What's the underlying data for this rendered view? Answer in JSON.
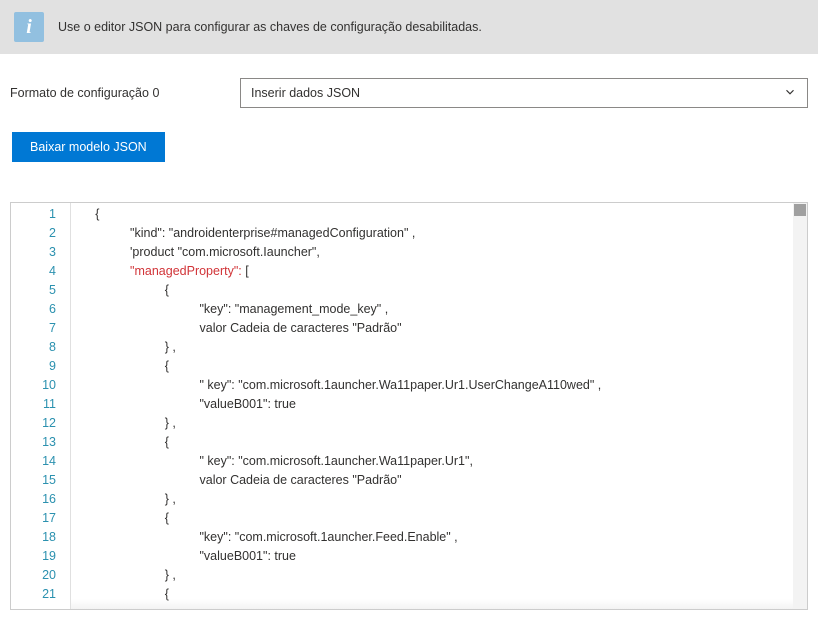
{
  "banner": {
    "icon_glyph": "i",
    "text": "Use o editor JSON para configurar as chaves de configuração desabilitadas."
  },
  "form": {
    "label": "Formato de configuração 0",
    "select_value": "Inserir dados JSON"
  },
  "buttons": {
    "download_template": "Baixar modelo JSON"
  },
  "editor": {
    "lines": [
      {
        "n": "1",
        "indent": 0,
        "text": "{"
      },
      {
        "n": "2",
        "indent": 2,
        "text": "\"kind\": \"androidenterprise#managedConfiguration\" ,"
      },
      {
        "n": "3",
        "indent": 2,
        "text": "'product \"com.microsoft.Iauncher\","
      },
      {
        "n": "4",
        "indent": 2,
        "text": "\"managedProperty\": [",
        "red": true
      },
      {
        "n": "5",
        "indent": 4,
        "text": "{"
      },
      {
        "n": "6",
        "indent": 6,
        "text": "\"key\": \"management_mode_key\" ,"
      },
      {
        "n": "7",
        "indent": 6,
        "text": "valor Cadeia de caracteres \"Padrão\""
      },
      {
        "n": "8",
        "indent": 4,
        "text": "} ,"
      },
      {
        "n": "9",
        "indent": 4,
        "text": "{"
      },
      {
        "n": "10",
        "indent": 6,
        "text": "\" key\": \"com.microsoft.1auncher.Wa11paper.Ur1.UserChangeA110wed\" ,"
      },
      {
        "n": "11",
        "indent": 6,
        "text": "\"valueB001\": true"
      },
      {
        "n": "12",
        "indent": 4,
        "text": "} ,"
      },
      {
        "n": "13",
        "indent": 4,
        "text": "{"
      },
      {
        "n": "14",
        "indent": 6,
        "text": "\" key\": \"com.microsoft.1auncher.Wa11paper.Ur1\","
      },
      {
        "n": "15",
        "indent": 6,
        "text": "valor Cadeia de caracteres \"Padrão\""
      },
      {
        "n": "16",
        "indent": 4,
        "text": "} ,"
      },
      {
        "n": "17",
        "indent": 4,
        "text": "{"
      },
      {
        "n": "18",
        "indent": 6,
        "text": "\"key\": \"com.microsoft.1auncher.Feed.Enable\" ,"
      },
      {
        "n": "19",
        "indent": 6,
        "text": "\"valueB001\": true"
      },
      {
        "n": "20",
        "indent": 4,
        "text": "} ,"
      },
      {
        "n": "21",
        "indent": 4,
        "text": "{"
      }
    ]
  }
}
